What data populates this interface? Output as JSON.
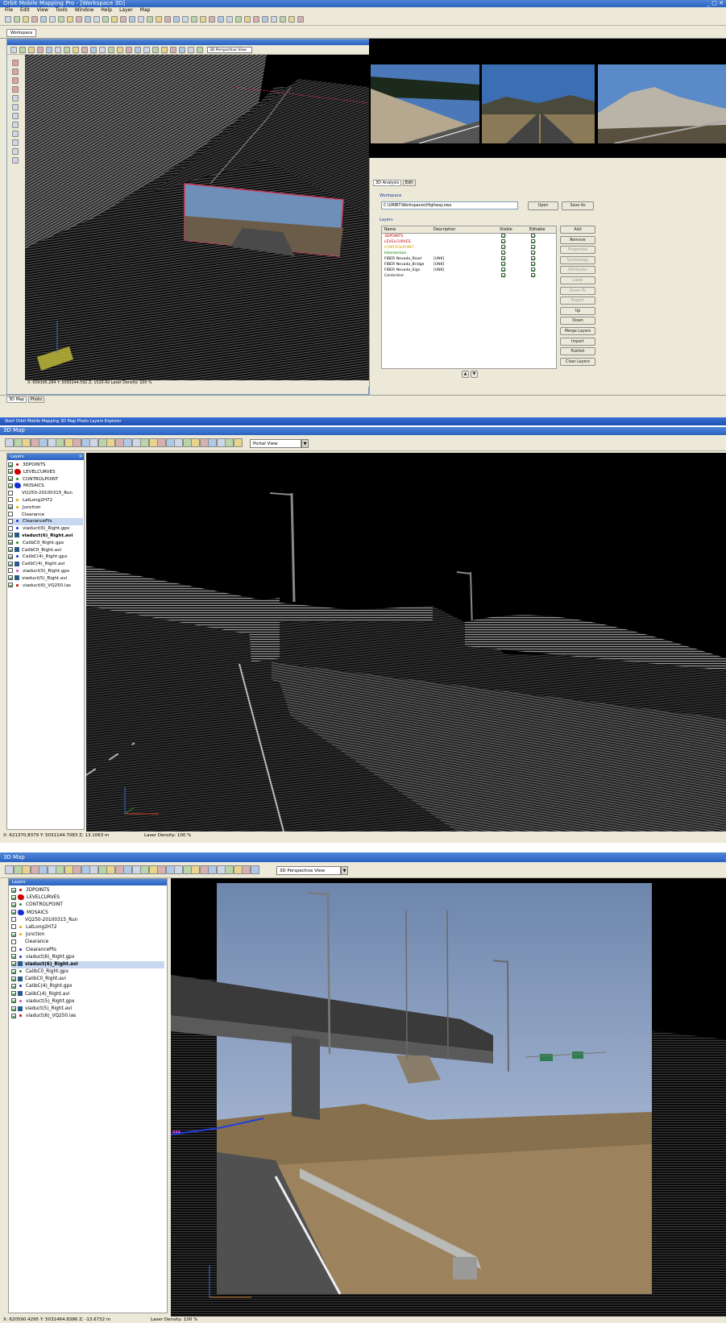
{
  "app1": {
    "title": "Orbit Mobile Mapping Pro - [Workspace 3D]",
    "menu": [
      "File",
      "Edit",
      "View",
      "Tools",
      "Window",
      "Help",
      "Layer",
      "Map"
    ],
    "tab_label": "Workspace",
    "map_view_select": "3D Perspective View",
    "statusbar": "X: 609395.264  Y: 5093244.592  Z: 1520.42  Laser Density: 100 %",
    "bottom_tabs": [
      "3D Map",
      "Photo"
    ],
    "analysis_tabs": [
      "3D Analysis",
      "Edit"
    ],
    "workspace_label": "Workspace",
    "workspace_value": "C:\\ORBIT\\Workspaces\\Highway.ows",
    "open_button": "Open",
    "save_as_button": "Save As",
    "layers_label": "Layers",
    "layer_table_headers": [
      "Name",
      "Description",
      "Visible",
      "Editable"
    ],
    "layer_table_rows": [
      {
        "name": "3DPOINTS",
        "desc": "",
        "color": "#c00000"
      },
      {
        "name": "LEVELCURVES",
        "desc": "",
        "color": "#c00000"
      },
      {
        "name": "CONTROLPOINT",
        "desc": "",
        "color": "#c8a000"
      },
      {
        "name": "Intersection",
        "desc": "",
        "color": "#008000"
      },
      {
        "name": "FIBER Nevada_Road",
        "desc": "[UNK]",
        "color": "#000"
      },
      {
        "name": "FIBER Nevada_Bridge",
        "desc": "[UNK]",
        "color": "#000"
      },
      {
        "name": "FIBER Nevada_Sign",
        "desc": "[UNK]",
        "color": "#000"
      },
      {
        "name": "Centerline",
        "desc": "",
        "color": "#000"
      }
    ],
    "side_buttons": [
      "Add",
      "Remove",
      "Properties",
      "Symbology",
      "Attributes",
      "Label",
      "Zoom To",
      "Export",
      "Up",
      "Down",
      "Merge Layers",
      "Import",
      "Publish",
      "Clear Layers"
    ],
    "taskbar": "Start   Orbit Mobile Mapping   3D Map   Photo   Layers   Explorer"
  },
  "app2": {
    "title": "3D Map",
    "view_select": "Portal View",
    "panel_title": "Layers",
    "layers": [
      {
        "label": "3DPOINTS",
        "checked": true,
        "icon": "point-symbol-icon",
        "color": "#c00000",
        "bold": false
      },
      {
        "label": "LEVELCURVES",
        "checked": true,
        "icon": "blob-symbol-icon",
        "color": "#d00000",
        "bold": false
      },
      {
        "label": "CONTROLPOINT",
        "checked": true,
        "icon": "point-symbol-icon",
        "color": "#2a8a2a",
        "bold": false
      },
      {
        "label": "MOSAICS",
        "checked": true,
        "icon": "blob-symbol-icon",
        "color": "#1a2ed6",
        "bold": false
      },
      {
        "label": "VQ250-20100315_Run",
        "checked": false,
        "icon": "none",
        "color": "#ffffff",
        "bold": false
      },
      {
        "label": "LatLong2H72",
        "checked": false,
        "icon": "point-symbol-icon",
        "color": "#e8a000",
        "bold": false
      },
      {
        "label": "Junction",
        "checked": true,
        "icon": "point-symbol-icon",
        "color": "#e8a000",
        "bold": false
      },
      {
        "label": "Clearance",
        "checked": false,
        "icon": "none",
        "color": "#ffffff",
        "bold": false
      },
      {
        "label": "ClearancePts",
        "checked": false,
        "icon": "point-symbol-icon",
        "color": "#1a2ed6",
        "bold": false,
        "selected": true
      },
      {
        "label": "viaduct(6)_Right.gpx",
        "checked": false,
        "icon": "point-symbol-icon",
        "color": "#1a2ed6",
        "bold": false
      },
      {
        "label": "viaduct(6)_Right.avi",
        "checked": true,
        "icon": "square-symbol-icon",
        "color": "#2a5a8a",
        "bold": true
      },
      {
        "label": "CalibC0_Right.gpx",
        "checked": true,
        "icon": "point-symbol-icon",
        "color": "#2a8a2a",
        "bold": false
      },
      {
        "label": "CalibC0_Right.avi",
        "checked": true,
        "icon": "square-symbol-icon",
        "color": "#2a5a8a",
        "bold": false
      },
      {
        "label": "CalibC(4)_Right.gpx",
        "checked": true,
        "icon": "point-symbol-icon",
        "color": "#1a2ed6",
        "bold": false
      },
      {
        "label": "CalibC(4)_Right.avi",
        "checked": true,
        "icon": "square-symbol-icon",
        "color": "#2a5a8a",
        "bold": false
      },
      {
        "label": "viaduct(5)_Right.gpx",
        "checked": false,
        "icon": "point-symbol-icon",
        "color": "#e040c0",
        "bold": false
      },
      {
        "label": "viaduct(5)_Right.avi",
        "checked": true,
        "icon": "square-symbol-icon",
        "color": "#2a5a8a",
        "bold": false
      },
      {
        "label": "viaduct(6)_VQ250.las",
        "checked": true,
        "icon": "point-symbol-icon",
        "color": "#c00000",
        "bold": false
      }
    ],
    "statusbar_coords": "X: 621370.8379   Y: 5031144.7083   Z: 13.1063 m",
    "statusbar_density": "Laser Density: 100 %"
  },
  "app3": {
    "title": "3D Map",
    "view_select": "3D Perspective View",
    "panel_title": "Layers",
    "layers": [
      {
        "label": "3DPOINTS",
        "checked": true,
        "icon": "point-symbol-icon",
        "color": "#c00000",
        "bold": false
      },
      {
        "label": "LEVELCURVES",
        "checked": true,
        "icon": "blob-symbol-icon",
        "color": "#d00000",
        "bold": false
      },
      {
        "label": "CONTROLPOINT",
        "checked": true,
        "icon": "point-symbol-icon",
        "color": "#2a8a2a",
        "bold": false
      },
      {
        "label": "MOSAICS",
        "checked": true,
        "icon": "blob-symbol-icon",
        "color": "#1a2ed6",
        "bold": false
      },
      {
        "label": "VQ250-20100315_Run",
        "checked": false,
        "icon": "none",
        "color": "#ffffff",
        "bold": false
      },
      {
        "label": "LatLong2H72",
        "checked": false,
        "icon": "point-symbol-icon",
        "color": "#e8a000",
        "bold": false
      },
      {
        "label": "Junction",
        "checked": true,
        "icon": "point-symbol-icon",
        "color": "#e8a000",
        "bold": false
      },
      {
        "label": "Clearance",
        "checked": false,
        "icon": "none",
        "color": "#ffffff",
        "bold": false
      },
      {
        "label": "ClearancePts",
        "checked": false,
        "icon": "point-symbol-icon",
        "color": "#1a2ed6",
        "bold": false
      },
      {
        "label": "viaduct(6)_Right.gpx",
        "checked": true,
        "icon": "point-symbol-icon",
        "color": "#1a2ed6",
        "bold": false
      },
      {
        "label": "viaduct(6)_Right.avi",
        "checked": true,
        "icon": "square-symbol-icon",
        "color": "#2a5a8a",
        "bold": true,
        "selected": true
      },
      {
        "label": "CalibC0_Right.gpx",
        "checked": true,
        "icon": "point-symbol-icon",
        "color": "#2a8a2a",
        "bold": false
      },
      {
        "label": "CalibC0_Right.avi",
        "checked": true,
        "icon": "square-symbol-icon",
        "color": "#2a5a8a",
        "bold": false
      },
      {
        "label": "CalibC(4)_Right.gpx",
        "checked": true,
        "icon": "point-symbol-icon",
        "color": "#1a2ed6",
        "bold": false
      },
      {
        "label": "CalibC(4)_Right.avi",
        "checked": true,
        "icon": "square-symbol-icon",
        "color": "#2a5a8a",
        "bold": false
      },
      {
        "label": "viaduct(5)_Right.gpx",
        "checked": true,
        "icon": "point-symbol-icon",
        "color": "#e040c0",
        "bold": false
      },
      {
        "label": "viaduct(5)_Right.avi",
        "checked": true,
        "icon": "square-symbol-icon",
        "color": "#2a5a8a",
        "bold": false
      },
      {
        "label": "viaduct(6)_VQ250.las",
        "checked": true,
        "icon": "point-symbol-icon",
        "color": "#c00000",
        "bold": false
      }
    ],
    "statusbar_coords": "X: 620590.4295   Y: 5031464.8386   Z: -13.6732 m",
    "statusbar_density": "Laser Density: 100 %"
  }
}
